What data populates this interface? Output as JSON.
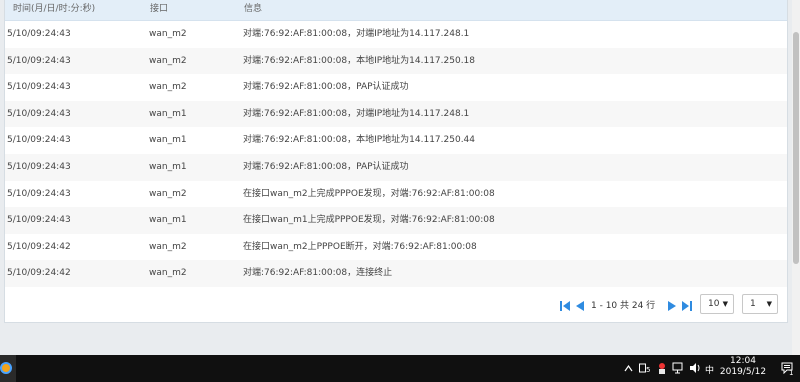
{
  "table": {
    "headers": [
      "时间(月/日/时:分:秒)",
      "接口",
      "信息"
    ],
    "rows": [
      {
        "time": "5/10/09:24:43",
        "iface": "wan_m2",
        "info": "对端:76:92:AF:81:00:08，对端IP地址为14.117.248.1"
      },
      {
        "time": "5/10/09:24:43",
        "iface": "wan_m2",
        "info": "对端:76:92:AF:81:00:08，本地IP地址为14.117.250.18"
      },
      {
        "time": "5/10/09:24:43",
        "iface": "wan_m2",
        "info": "对端:76:92:AF:81:00:08，PAP认证成功"
      },
      {
        "time": "5/10/09:24:43",
        "iface": "wan_m1",
        "info": "对端:76:92:AF:81:00:08，对端IP地址为14.117.248.1"
      },
      {
        "time": "5/10/09:24:43",
        "iface": "wan_m1",
        "info": "对端:76:92:AF:81:00:08，本地IP地址为14.117.250.44"
      },
      {
        "time": "5/10/09:24:43",
        "iface": "wan_m1",
        "info": "对端:76:92:AF:81:00:08，PAP认证成功"
      },
      {
        "time": "5/10/09:24:43",
        "iface": "wan_m2",
        "info": "在接口wan_m2上完成PPPOE发现，对端:76:92:AF:81:00:08"
      },
      {
        "time": "5/10/09:24:43",
        "iface": "wan_m1",
        "info": "在接口wan_m1上完成PPPOE发现，对端:76:92:AF:81:00:08"
      },
      {
        "time": "5/10/09:24:42",
        "iface": "wan_m2",
        "info": "在接口wan_m2上PPPOE断开，对端:76:92:AF:81:00:08"
      },
      {
        "time": "5/10/09:24:42",
        "iface": "wan_m2",
        "info": "对端:76:92:AF:81:00:08，连接终止"
      }
    ]
  },
  "pager": {
    "summary": "1 - 10 共 24 行",
    "page_size": "10",
    "page": "1",
    "icons": [
      "first-page-icon",
      "prev-page-icon",
      "next-page-icon",
      "last-page-icon"
    ],
    "accent": "#2f8be0"
  },
  "taskbar": {
    "ime": "中",
    "time": "12:04",
    "date": "2019/5/12",
    "tray_icons": [
      "chevron-up-icon",
      "ime-icon",
      "app-tray-icon",
      "network-icon",
      "volume-icon"
    ]
  }
}
